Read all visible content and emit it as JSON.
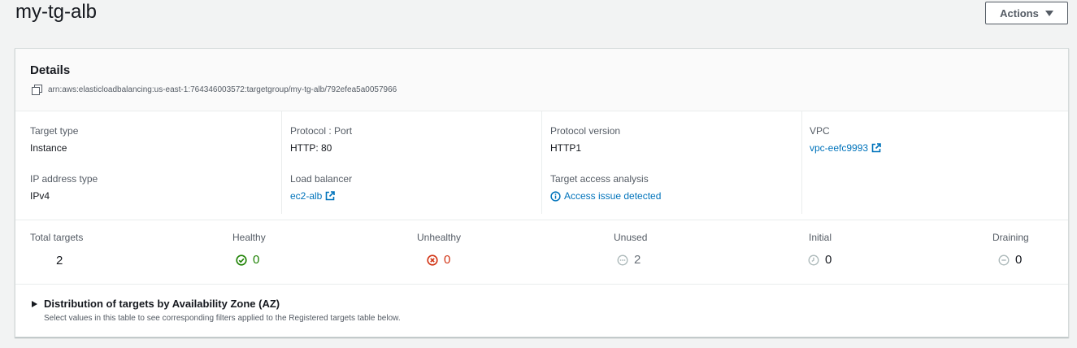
{
  "page": {
    "title": "my-tg-alb"
  },
  "actions": {
    "label": "Actions"
  },
  "details": {
    "title": "Details",
    "arn": "arn:aws:elasticloadbalancing:us-east-1:764346003572:targetgroup/my-tg-alb/792efea5a0057966"
  },
  "fields": {
    "target_type": {
      "label": "Target type",
      "value": "Instance"
    },
    "ip_address_type": {
      "label": "IP address type",
      "value": "IPv4"
    },
    "protocol_port": {
      "label": "Protocol : Port",
      "value": "HTTP: 80"
    },
    "load_balancer": {
      "label": "Load balancer",
      "value": "ec2-alb"
    },
    "protocol_version": {
      "label": "Protocol version",
      "value": "HTTP1"
    },
    "target_access_analysis": {
      "label": "Target access analysis",
      "value": "Access issue detected"
    },
    "vpc": {
      "label": "VPC",
      "value": "vpc-eefc9993"
    }
  },
  "stats": {
    "total": {
      "label": "Total targets",
      "value": "2"
    },
    "healthy": {
      "label": "Healthy",
      "value": "0",
      "icon": "check-circle-icon",
      "color": "#1d8102"
    },
    "unhealthy": {
      "label": "Unhealthy",
      "value": "0",
      "icon": "x-circle-icon",
      "color": "#d13212"
    },
    "unused": {
      "label": "Unused",
      "value": "2",
      "icon": "ellipsis-circle-icon",
      "color": "#687078"
    },
    "initial": {
      "label": "Initial",
      "value": "0",
      "icon": "clock-circle-icon",
      "color": "#687078"
    },
    "draining": {
      "label": "Draining",
      "value": "0",
      "icon": "minus-circle-icon",
      "color": "#687078"
    }
  },
  "az": {
    "title": "Distribution of targets by Availability Zone (AZ)",
    "description": "Select values in this table to see corresponding filters applied to the Registered targets table below."
  },
  "colors": {
    "link": "#0073bb",
    "text": "#16191f",
    "secondary": "#545b64"
  }
}
